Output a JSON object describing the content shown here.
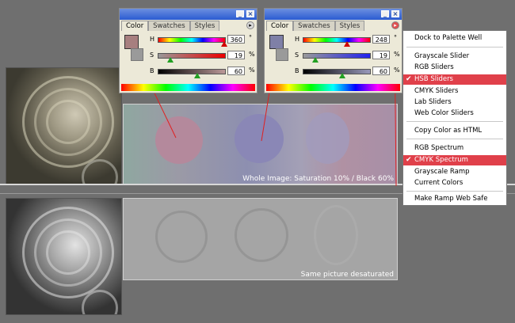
{
  "panels": [
    {
      "tabs": [
        "Color",
        "Swatches",
        "Styles"
      ],
      "h": "360",
      "s": "19",
      "b": "60",
      "fg_color": "#a77f7f"
    },
    {
      "tabs": [
        "Color",
        "Swatches",
        "Styles"
      ],
      "h": "248",
      "s": "19",
      "b": "60",
      "fg_color": "#7f80a7"
    }
  ],
  "slider_labels": {
    "h": "H",
    "s": "S",
    "b": "B"
  },
  "units": {
    "h": "°",
    "s": "%",
    "b": "%"
  },
  "captions": {
    "color": "Whole Image:  Saturation 10% / Black 60%",
    "gray": "Same picture desaturated"
  },
  "menu": {
    "items": [
      {
        "label": "Dock to Palette Well",
        "checked": false
      },
      {
        "label": "Grayscale Slider",
        "checked": false
      },
      {
        "label": "RGB Sliders",
        "checked": false
      },
      {
        "label": "HSB Sliders",
        "checked": true
      },
      {
        "label": "CMYK Sliders",
        "checked": false
      },
      {
        "label": "Lab Sliders",
        "checked": false
      },
      {
        "label": "Web Color Sliders",
        "checked": false
      },
      {
        "label": "Copy Color as HTML",
        "checked": false
      },
      {
        "label": "RGB Spectrum",
        "checked": false
      },
      {
        "label": "CMYK Spectrum",
        "checked": true
      },
      {
        "label": "Grayscale Ramp",
        "checked": false
      },
      {
        "label": "Current Colors",
        "checked": false
      },
      {
        "label": "Make Ramp Web Safe",
        "checked": false
      }
    ]
  },
  "colors": {
    "highlight": "#e0404a",
    "titlebar": "#2b5bd2",
    "pointer_line": "#e02020"
  }
}
